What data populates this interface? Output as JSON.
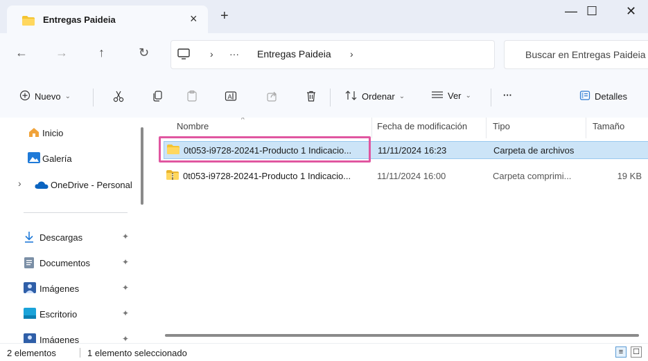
{
  "window": {
    "tab_title": "Entregas Paideia",
    "tab_close_glyph": "×",
    "new_tab_glyph": "+",
    "minimize_glyph": "—",
    "maximize_glyph": "☐",
    "close_glyph": "✕"
  },
  "addressbar": {
    "back_glyph": "←",
    "forward_glyph": "→",
    "up_glyph": "↑",
    "refresh_glyph": "↻",
    "sep1": "›",
    "ellipsis": "···",
    "crumb": "Entregas Paideia",
    "sep2": "›",
    "search_placeholder": "Buscar en Entregas Paideia"
  },
  "toolbar": {
    "new_label": "Nuevo",
    "sort_label": "Ordenar",
    "view_label": "Ver",
    "more_glyph": "···",
    "details_label": "Detalles",
    "chevron": "⌄"
  },
  "sidebar": {
    "items": [
      {
        "label": "Inicio"
      },
      {
        "label": "Galería"
      },
      {
        "label": "OneDrive - Personal"
      },
      {
        "label": "Descargas"
      },
      {
        "label": "Documentos"
      },
      {
        "label": "Imágenes"
      },
      {
        "label": "Escritorio"
      },
      {
        "label": "Imágenes"
      }
    ],
    "expand_glyph": "›",
    "pin_glyph": "✦"
  },
  "list": {
    "columns": [
      "Nombre",
      "Fecha de modificación",
      "Tipo",
      "Tamaño"
    ],
    "sort_caret": "^",
    "rows": [
      {
        "name": "0t053-i9728-20241-Producto 1 Indicacio...",
        "date": "11/11/2024 16:23",
        "type": "Carpeta de archivos",
        "size": ""
      },
      {
        "name": "0t053-i9728-20241-Producto 1 Indicacio...",
        "date": "11/11/2024 16:00",
        "type": "Carpeta comprimi...",
        "size": "19 KB"
      }
    ]
  },
  "statusbar": {
    "count": "2 elementos",
    "selection": "1 elemento seleccionado"
  },
  "colors": {
    "accent_highlight": "#e056a0",
    "selection_bg": "#cce4f7",
    "folder_yellow": "#f4c430"
  }
}
